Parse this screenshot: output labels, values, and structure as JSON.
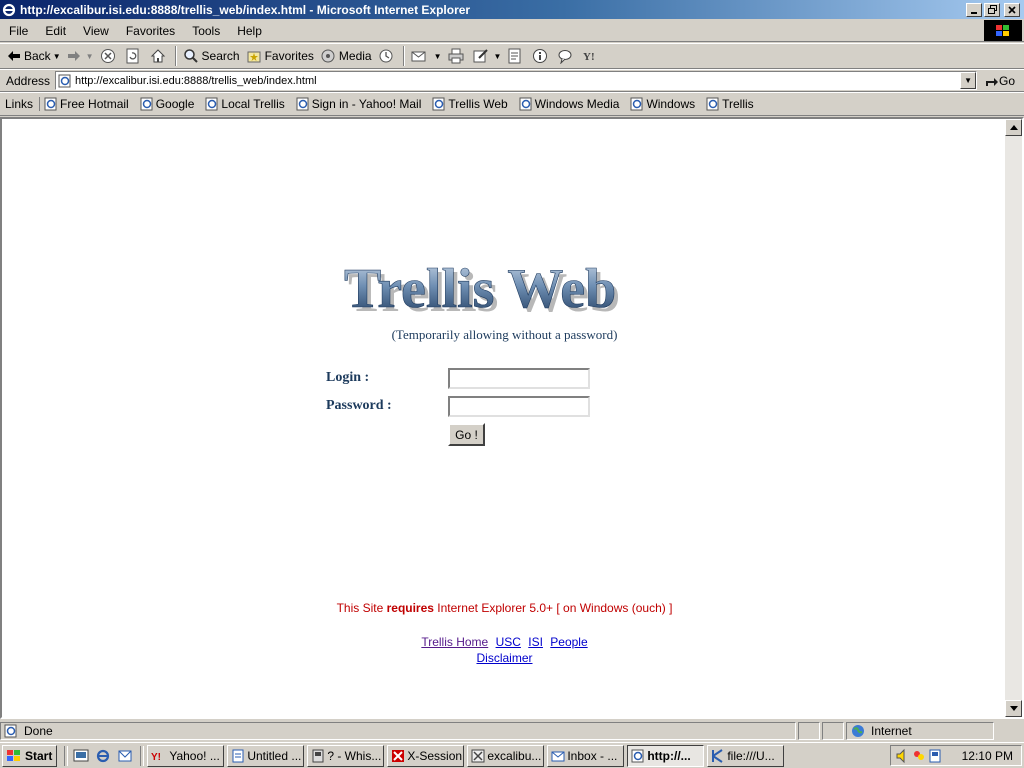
{
  "window": {
    "title": "http://excalibur.isi.edu:8888/trellis_web/index.html - Microsoft Internet Explorer"
  },
  "menu": [
    "File",
    "Edit",
    "View",
    "Favorites",
    "Tools",
    "Help"
  ],
  "toolbar": {
    "back_label": "Back",
    "search_label": "Search",
    "favorites_label": "Favorites",
    "media_label": "Media"
  },
  "address": {
    "label": "Address",
    "url": "http://excalibur.isi.edu:8888/trellis_web/index.html",
    "go_label": "Go"
  },
  "links": {
    "label": "Links",
    "items": [
      "Free Hotmail",
      "Google",
      "Local Trellis",
      "Sign in - Yahoo! Mail",
      "Trellis Web",
      "Windows Media",
      "Windows",
      "Trellis"
    ]
  },
  "page": {
    "logo_text": "Trellis Web",
    "subtitle": "(Temporarily allowing without a password)",
    "login_label": "Login :",
    "password_label": "Password :",
    "go_button": "Go !",
    "requirement": {
      "prefix": "This Site ",
      "emphasis": "requires",
      "suffix": " Internet Explorer 5.0+ [ on Windows (ouch) ]"
    },
    "footer_links": [
      "Trellis Home",
      "USC",
      "ISI",
      "People"
    ],
    "disclaimer": "Disclaimer"
  },
  "status": {
    "text": "Done",
    "zone": "Internet"
  },
  "taskbar": {
    "start_label": "Start",
    "tasks": [
      "Yahoo! ...",
      "Untitled ...",
      "? - Whis...",
      "X-Session",
      "excalibu...",
      "Inbox - ...",
      "http://...",
      "file:///U..."
    ],
    "active_index": 6,
    "clock": "12:10 PM"
  },
  "colors": {
    "titlebar_start": "#0a246a",
    "titlebar_end": "#a6caf0",
    "chrome": "#d4d0c8",
    "page_text": "#1c3a5c",
    "requirement_text": "#c00000",
    "visited_link": "#551a8b",
    "link": "#0000cc"
  }
}
